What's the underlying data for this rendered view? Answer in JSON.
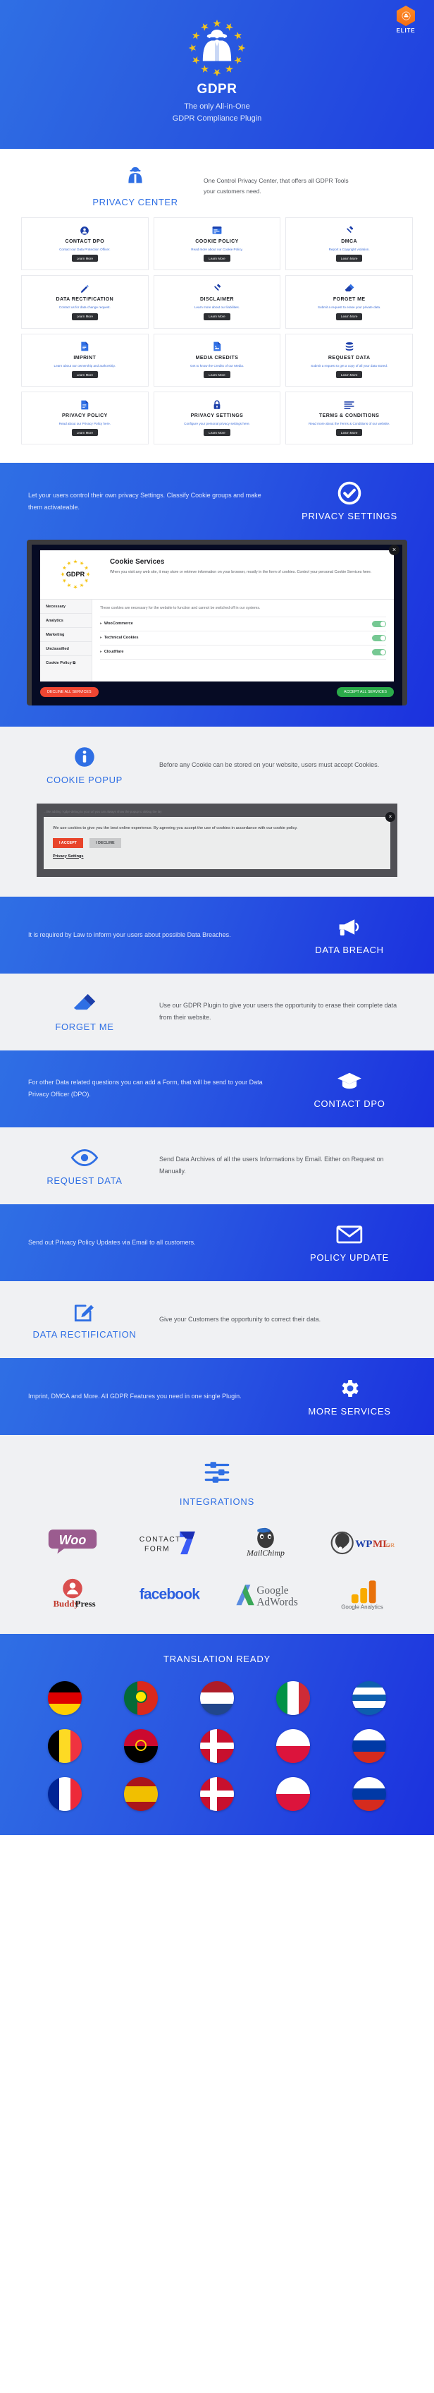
{
  "hero": {
    "badge": {
      "icon": "elite-hex-icon",
      "label": "ELITE"
    },
    "logo_icon": "gdpr-spy-eu-stars-logo",
    "title": "GDPR",
    "subtitle_line1": "The only All-in-One",
    "subtitle_line2": "GDPR Compliance Plugin"
  },
  "privacy_center": {
    "icon": "spy-agent-icon",
    "title": "PRIVACY CENTER",
    "description": "One Control Privacy Center, that offers all GDPR Tools your customers need.",
    "button_label": "Learn More",
    "cards": [
      {
        "icon": "user-circle-icon",
        "title": "CONTACT DPO",
        "desc": "Contact our Data Protection Officer."
      },
      {
        "icon": "cookie-window-icon",
        "title": "COOKIE POLICY",
        "desc": "Read more about our Cookie Policy."
      },
      {
        "icon": "gavel-icon",
        "title": "DMCA",
        "desc": "Report a Copyright violation."
      },
      {
        "icon": "pencil-icon",
        "title": "DATA RECTIFICATION",
        "desc": "Contact us for data change request."
      },
      {
        "icon": "gavel-icon",
        "title": "DISCLAIMER",
        "desc": "Learn more about our liabilities."
      },
      {
        "icon": "eraser-icon",
        "title": "FORGET ME",
        "desc": "Submit a request to erase your private data."
      },
      {
        "icon": "document-icon",
        "title": "IMPRINT",
        "desc": "Learn about our ownership and authorship."
      },
      {
        "icon": "image-file-icon",
        "title": "MEDIA CREDITS",
        "desc": "Get to know the Credits of our Media."
      },
      {
        "icon": "database-icon",
        "title": "REQUEST DATA",
        "desc": "Submit a request to get a copy of all your data stored."
      },
      {
        "icon": "document-icon",
        "title": "PRIVACY POLICY",
        "desc": "Read about our Privacy Policy here."
      },
      {
        "icon": "lock-icon",
        "title": "PRIVACY SETTINGS",
        "desc": "Configure your personal privacy settings here."
      },
      {
        "icon": "list-lines-icon",
        "title": "TERMS & CONDITIONS",
        "desc": "Read more about the Terms & Conditions of our website."
      }
    ]
  },
  "bands": [
    {
      "id": "privacy-settings",
      "icon": "check-circle-icon",
      "title": "PRIVACY SETTINGS",
      "text": "Let your users control their own privacy Settings. Classify Cookie groups and make them activateable.",
      "theme": "blue",
      "reversed": false
    },
    {
      "id": "cookie-popup",
      "icon": "info-circle-icon",
      "title": "COOKIE POPUP",
      "text": "Before any Cookie can be stored on your website, users must accept Cookies.",
      "theme": "grey",
      "reversed": false
    },
    {
      "id": "data-breach",
      "icon": "megaphone-icon",
      "title": "DATA BREACH",
      "text": "It is required by Law to inform your users about possible Data Breaches.",
      "theme": "blue",
      "reversed": true
    },
    {
      "id": "forget-me",
      "icon": "eraser-icon",
      "title": "FORGET ME",
      "text": "Use our GDPR Plugin to give your users the opportunity to erase their complete data from their website.",
      "theme": "grey",
      "reversed": false
    },
    {
      "id": "contact-dpo",
      "icon": "graduation-cap-icon",
      "title": "CONTACT DPO",
      "text": "For other Data related questions you can add a Form, that will be send to your Data Privacy Officer (DPO).",
      "theme": "blue",
      "reversed": true
    },
    {
      "id": "request-data",
      "icon": "eye-icon",
      "title": "REQUEST DATA",
      "text": "Send Data Archives of all the users Informations by Email. Either on Request on Manually.",
      "theme": "grey",
      "reversed": false
    },
    {
      "id": "policy-update",
      "icon": "envelope-icon",
      "title": "POLICY UPDATE",
      "text": "Send out Privacy Policy Updates via Email to all customers.",
      "theme": "blue",
      "reversed": true
    },
    {
      "id": "data-rectification",
      "icon": "edit-square-icon",
      "title": "DATA RECTIFICATION",
      "text": "Give your Customers the opportunity to correct their data.",
      "theme": "grey",
      "reversed": false
    },
    {
      "id": "more-services",
      "icon": "gear-icon",
      "title": "MORE SERVICES",
      "text": "Imprint, DMCA and More. All GDPR Features you need in one single Plugin.",
      "theme": "blue",
      "reversed": true
    }
  ],
  "cookie_services_modal": {
    "close_icon": "close-icon",
    "logo_text": "GDPR",
    "logo_icon": "gdpr-eu-stars-logo",
    "heading": "Cookie Services",
    "paragraph": "When you visit any web site, it may store or retrieve information on your browser, mostly in the form of cookies. Control your personal Cookie Services here.",
    "tabs": [
      "Necessary",
      "Analytics",
      "Marketing",
      "Unclassified",
      "Cookie Policy"
    ],
    "tab_external_icon": "external-link-icon",
    "pane_note": "These cookies are necessary for the website to function and cannot be switched off in our systems.",
    "services": [
      {
        "name": "WooCommerce",
        "enabled": true
      },
      {
        "name": "Technical Cookies",
        "enabled": true
      },
      {
        "name": "Cloudflare",
        "enabled": true
      }
    ],
    "decline_label": "DECLINE ALL SERVICES",
    "accept_label": "ACCEPT ALL SERVICES"
  },
  "cookie_banner": {
    "debug_note": "...like adding ?gdpr-debug to your url you can always show the popup to debug the lay",
    "close_icon": "close-icon",
    "message": "We use cookies to give you the best online experience. By agreeing you accept the use of cookies in accordance with our cookie policy.",
    "accept_label": "I ACCEPT",
    "decline_label": "I DECLINE",
    "settings_link": "Privacy Settings"
  },
  "integrations": {
    "icon": "sliders-icon",
    "title": "INTEGRATIONS",
    "logos": [
      {
        "name": "woocommerce-logo",
        "label": "Woo"
      },
      {
        "name": "contact-form-7-logo",
        "label": "CONTACT FORM 7"
      },
      {
        "name": "mailchimp-logo",
        "label": "MailChimp"
      },
      {
        "name": "wpml-logo",
        "label": "WPML.ORG"
      },
      {
        "name": "buddypress-logo",
        "label": "BuddyPress"
      },
      {
        "name": "facebook-logo",
        "label": "facebook"
      },
      {
        "name": "google-adwords-logo",
        "label": "Google AdWords"
      },
      {
        "name": "google-analytics-logo",
        "label": "Google Analytics"
      }
    ]
  },
  "translation": {
    "title": "TRANSLATION READY",
    "flags": [
      {
        "name": "flag-germany",
        "type": "h",
        "colors": [
          "#000000",
          "#dd0000",
          "#ffce00"
        ]
      },
      {
        "name": "flag-portugal",
        "type": "v",
        "colors": [
          "#046a38",
          "#046a38",
          "#da291c"
        ]
      },
      {
        "name": "flag-netherlands",
        "type": "h",
        "colors": [
          "#ae1c28",
          "#ffffff",
          "#21468b"
        ]
      },
      {
        "name": "flag-italy",
        "type": "v",
        "colors": [
          "#009246",
          "#ffffff",
          "#ce2b37"
        ]
      },
      {
        "name": "flag-greece",
        "type": "h",
        "colors": [
          "#0d5eaf",
          "#ffffff",
          "#0d5eaf"
        ]
      },
      {
        "name": "flag-belgium",
        "type": "v",
        "colors": [
          "#000000",
          "#fdda24",
          "#ef3340"
        ]
      },
      {
        "name": "flag-angola",
        "type": "h",
        "colors": [
          "#cc092f",
          "#cc092f",
          "#000000"
        ]
      },
      {
        "name": "flag-denmark",
        "type": "cross",
        "colors": [
          "#c8102e",
          "#ffffff"
        ]
      },
      {
        "name": "flag-poland",
        "type": "h",
        "colors": [
          "#ffffff",
          "#ffffff",
          "#dc143c"
        ]
      },
      {
        "name": "flag-russia",
        "type": "h",
        "colors": [
          "#ffffff",
          "#0039a6",
          "#d52b1e"
        ]
      },
      {
        "name": "flag-france",
        "type": "v",
        "colors": [
          "#002395",
          "#ffffff",
          "#ed2939"
        ]
      },
      {
        "name": "flag-spain",
        "type": "h",
        "colors": [
          "#aa151b",
          "#f1bf00",
          "#aa151b"
        ]
      },
      {
        "name": "flag-denmark-2",
        "type": "cross",
        "colors": [
          "#c8102e",
          "#ffffff"
        ]
      },
      {
        "name": "flag-poland-2",
        "type": "h",
        "colors": [
          "#ffffff",
          "#ffffff",
          "#dc143c"
        ]
      },
      {
        "name": "flag-russia-2",
        "type": "h",
        "colors": [
          "#ffffff",
          "#0039a6",
          "#d52b1e"
        ]
      }
    ]
  },
  "colors": {
    "brand_blue": "#2f6fe4",
    "deep_blue": "#1b31de",
    "accent_orange": "#f36d12",
    "card_dark": "#2d2f33",
    "toggle_green": "#76c893",
    "accept_green": "#2bab4a",
    "decline_red": "#f04632"
  }
}
